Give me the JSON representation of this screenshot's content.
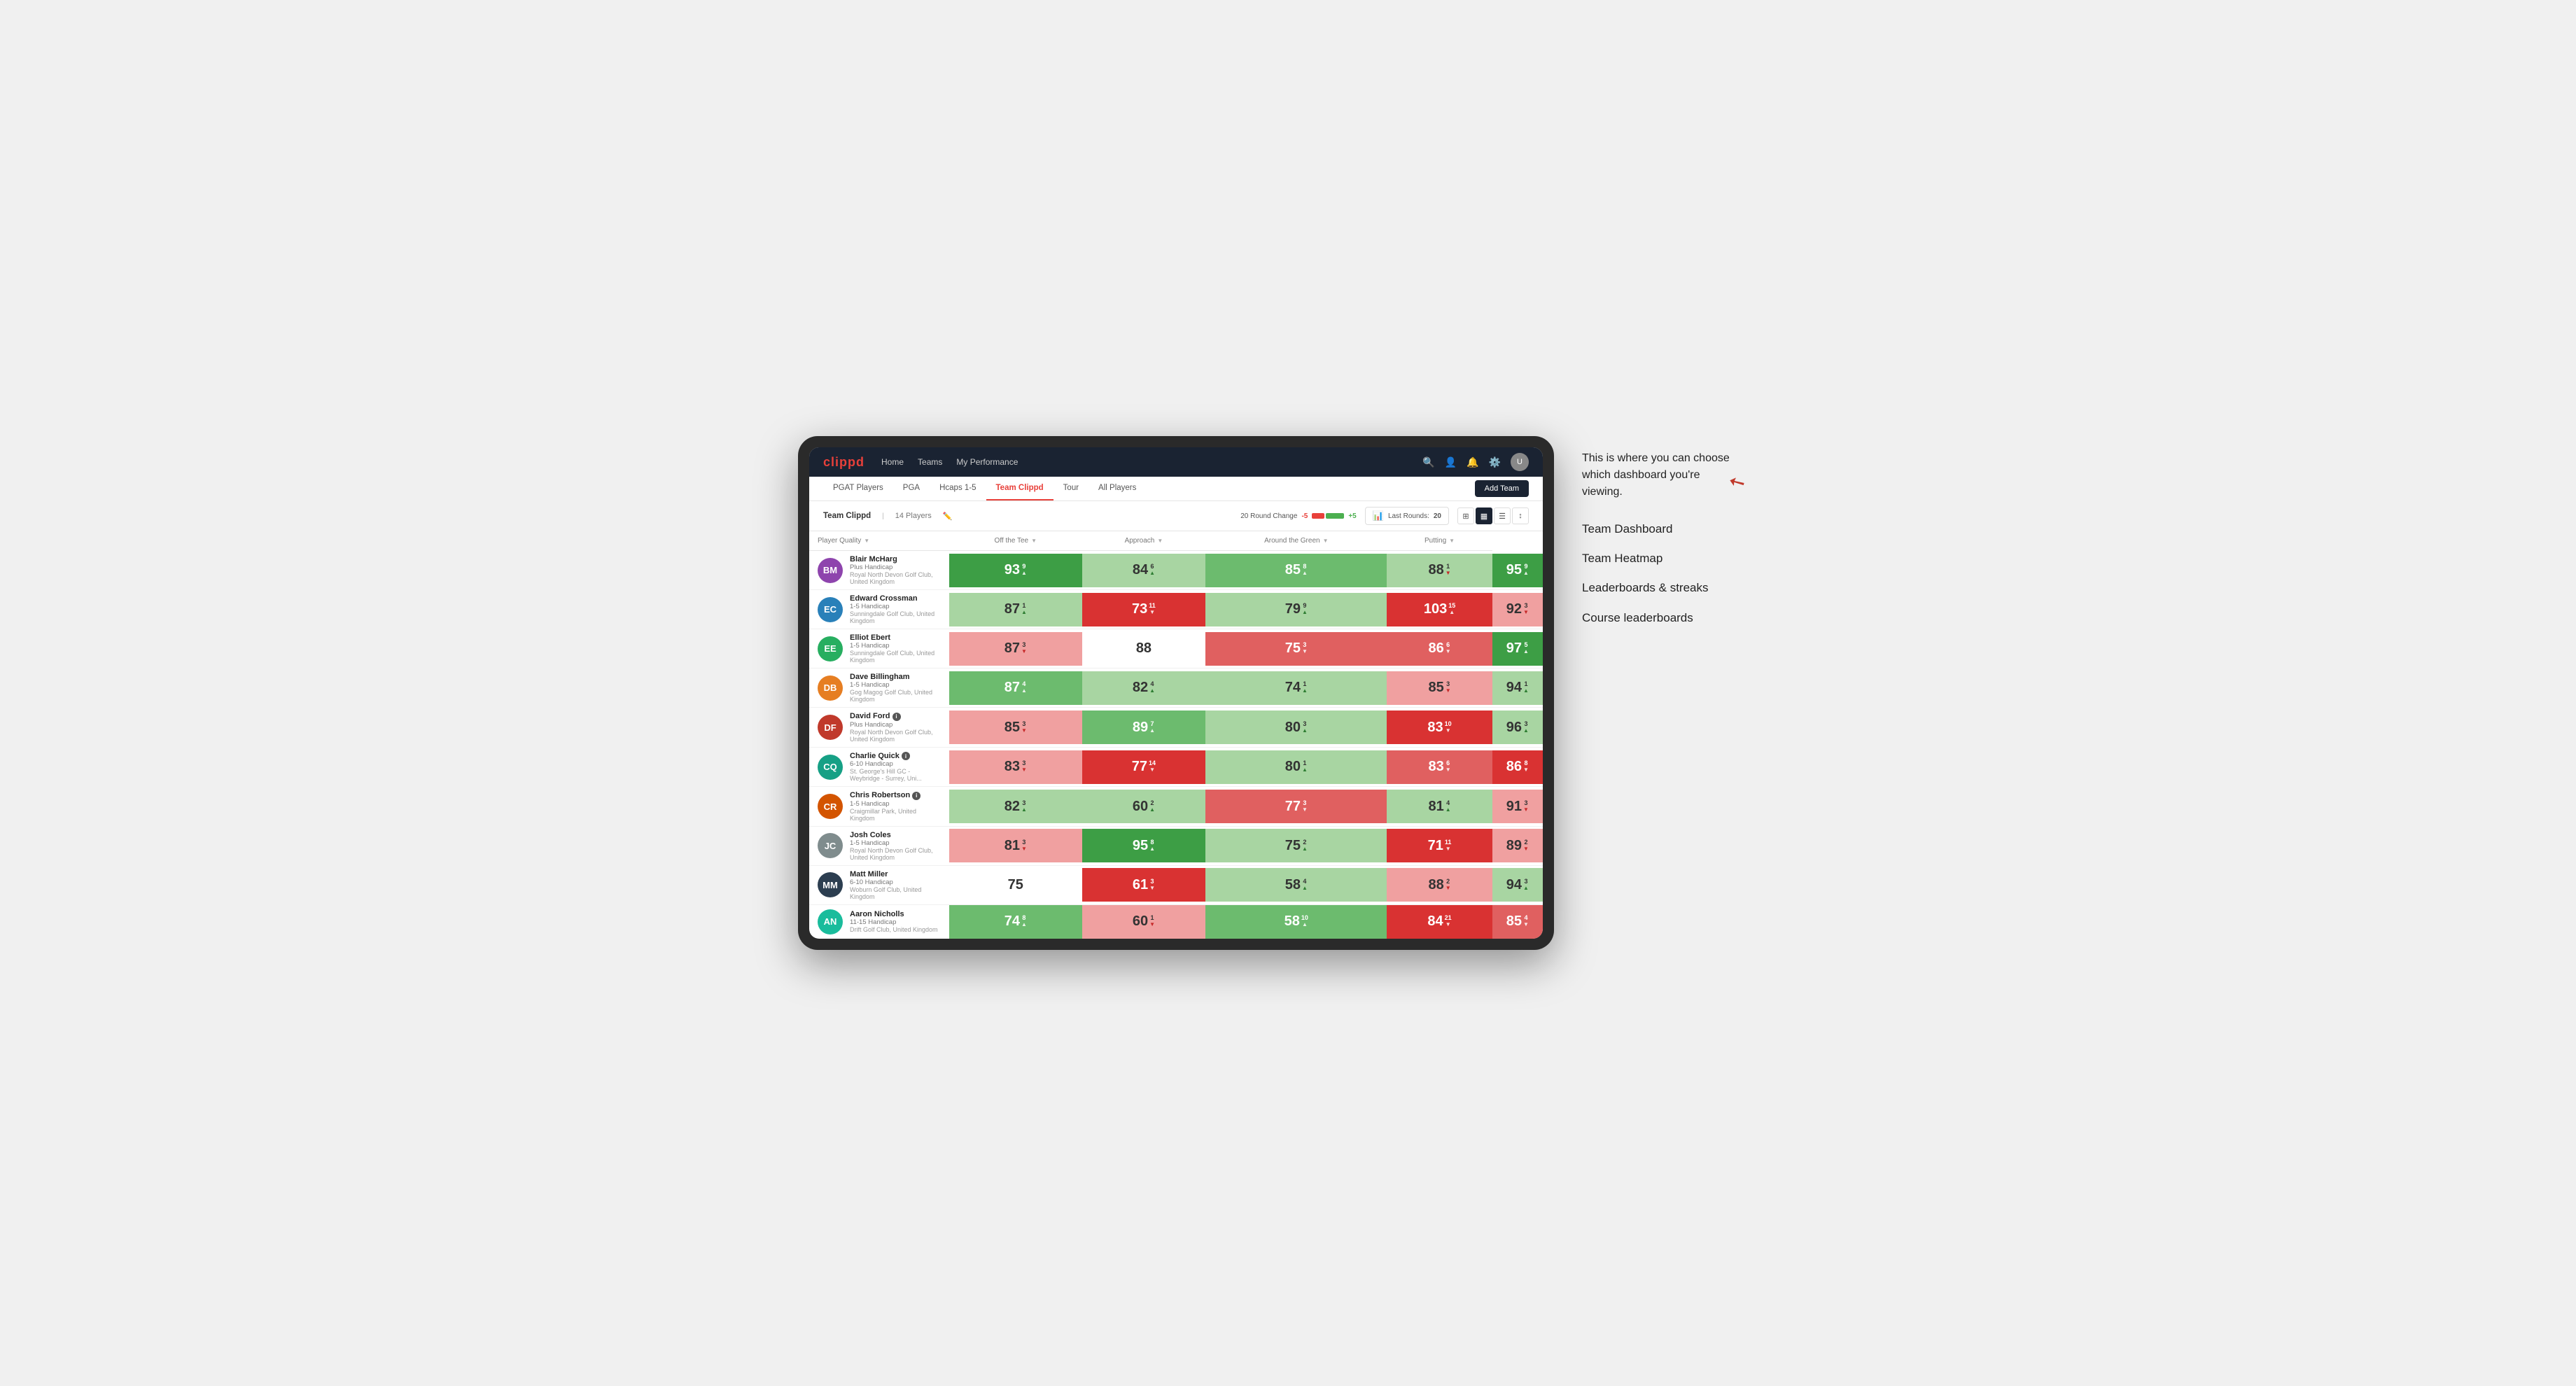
{
  "annotation": {
    "text": "This is where you can choose which dashboard you're viewing.",
    "items": [
      "Team Dashboard",
      "Team Heatmap",
      "Leaderboards & streaks",
      "Course leaderboards"
    ]
  },
  "nav": {
    "logo": "clippd",
    "links": [
      {
        "label": "Home",
        "active": false
      },
      {
        "label": "Teams",
        "active": false
      },
      {
        "label": "My Performance",
        "active": false
      }
    ],
    "icons": [
      "search",
      "user",
      "bell",
      "settings",
      "avatar"
    ]
  },
  "sub_nav": {
    "links": [
      {
        "label": "PGAT Players",
        "active": false
      },
      {
        "label": "PGA",
        "active": false
      },
      {
        "label": "Hcaps 1-5",
        "active": false
      },
      {
        "label": "Team Clippd",
        "active": true
      },
      {
        "label": "Tour",
        "active": false
      },
      {
        "label": "All Players",
        "active": false
      }
    ],
    "add_team_label": "Add Team"
  },
  "team_header": {
    "team_name": "Team Clippd",
    "player_count": "14 Players",
    "round_change_label": "20 Round Change",
    "change_minus": "-5",
    "change_plus": "+5",
    "last_rounds_label": "Last Rounds:",
    "last_rounds_value": "20"
  },
  "table": {
    "columns": [
      {
        "label": "Player Quality",
        "sort": true
      },
      {
        "label": "Off the Tee",
        "sort": true
      },
      {
        "label": "Approach",
        "sort": true
      },
      {
        "label": "Around the Green",
        "sort": true
      },
      {
        "label": "Putting",
        "sort": true
      }
    ],
    "players": [
      {
        "name": "Blair McHarg",
        "handicap": "Plus Handicap",
        "club": "Royal North Devon Golf Club, United Kingdom",
        "initials": "BM",
        "scores": [
          {
            "value": "93",
            "change": "9",
            "dir": "up",
            "color": "green-dark"
          },
          {
            "value": "84",
            "change": "6",
            "dir": "up",
            "color": "green-light"
          },
          {
            "value": "85",
            "change": "8",
            "dir": "up",
            "color": "green-mid"
          },
          {
            "value": "88",
            "change": "1",
            "dir": "down",
            "color": "green-light"
          },
          {
            "value": "95",
            "change": "9",
            "dir": "up",
            "color": "green-dark"
          }
        ]
      },
      {
        "name": "Edward Crossman",
        "handicap": "1-5 Handicap",
        "club": "Sunningdale Golf Club, United Kingdom",
        "initials": "EC",
        "scores": [
          {
            "value": "87",
            "change": "1",
            "dir": "up",
            "color": "green-light"
          },
          {
            "value": "73",
            "change": "11",
            "dir": "down",
            "color": "red-dark"
          },
          {
            "value": "79",
            "change": "9",
            "dir": "up",
            "color": "green-light"
          },
          {
            "value": "103",
            "change": "15",
            "dir": "up",
            "color": "red-dark"
          },
          {
            "value": "92",
            "change": "3",
            "dir": "down",
            "color": "red-light"
          }
        ]
      },
      {
        "name": "Elliot Ebert",
        "handicap": "1-5 Handicap",
        "club": "Sunningdale Golf Club, United Kingdom",
        "initials": "EE",
        "scores": [
          {
            "value": "87",
            "change": "3",
            "dir": "down",
            "color": "red-light"
          },
          {
            "value": "88",
            "change": "",
            "dir": "",
            "color": "white"
          },
          {
            "value": "75",
            "change": "3",
            "dir": "down",
            "color": "red-mid"
          },
          {
            "value": "86",
            "change": "6",
            "dir": "down",
            "color": "red-mid"
          },
          {
            "value": "97",
            "change": "5",
            "dir": "up",
            "color": "green-dark"
          }
        ]
      },
      {
        "name": "Dave Billingham",
        "handicap": "1-5 Handicap",
        "club": "Gog Magog Golf Club, United Kingdom",
        "initials": "DB",
        "scores": [
          {
            "value": "87",
            "change": "4",
            "dir": "up",
            "color": "green-mid"
          },
          {
            "value": "82",
            "change": "4",
            "dir": "up",
            "color": "green-light"
          },
          {
            "value": "74",
            "change": "1",
            "dir": "up",
            "color": "green-light"
          },
          {
            "value": "85",
            "change": "3",
            "dir": "down",
            "color": "red-light"
          },
          {
            "value": "94",
            "change": "1",
            "dir": "up",
            "color": "green-light"
          }
        ]
      },
      {
        "name": "David Ford",
        "handicap": "Plus Handicap",
        "club": "Royal North Devon Golf Club, United Kingdom",
        "initials": "DF",
        "has_info": true,
        "scores": [
          {
            "value": "85",
            "change": "3",
            "dir": "down",
            "color": "red-light"
          },
          {
            "value": "89",
            "change": "7",
            "dir": "up",
            "color": "green-mid"
          },
          {
            "value": "80",
            "change": "3",
            "dir": "up",
            "color": "green-light"
          },
          {
            "value": "83",
            "change": "10",
            "dir": "down",
            "color": "red-dark"
          },
          {
            "value": "96",
            "change": "3",
            "dir": "up",
            "color": "green-light"
          }
        ]
      },
      {
        "name": "Charlie Quick",
        "handicap": "6-10 Handicap",
        "club": "St. George's Hill GC - Weybridge - Surrey, Uni...",
        "initials": "CQ",
        "has_info": true,
        "scores": [
          {
            "value": "83",
            "change": "3",
            "dir": "down",
            "color": "red-light"
          },
          {
            "value": "77",
            "change": "14",
            "dir": "down",
            "color": "red-dark"
          },
          {
            "value": "80",
            "change": "1",
            "dir": "up",
            "color": "green-light"
          },
          {
            "value": "83",
            "change": "6",
            "dir": "down",
            "color": "red-mid"
          },
          {
            "value": "86",
            "change": "8",
            "dir": "down",
            "color": "red-dark"
          }
        ]
      },
      {
        "name": "Chris Robertson",
        "handicap": "1-5 Handicap",
        "club": "Craigmillar Park, United Kingdom",
        "initials": "CR",
        "has_info": true,
        "scores": [
          {
            "value": "82",
            "change": "3",
            "dir": "up",
            "color": "green-light"
          },
          {
            "value": "60",
            "change": "2",
            "dir": "up",
            "color": "green-light"
          },
          {
            "value": "77",
            "change": "3",
            "dir": "down",
            "color": "red-mid"
          },
          {
            "value": "81",
            "change": "4",
            "dir": "up",
            "color": "green-light"
          },
          {
            "value": "91",
            "change": "3",
            "dir": "down",
            "color": "red-light"
          }
        ]
      },
      {
        "name": "Josh Coles",
        "handicap": "1-5 Handicap",
        "club": "Royal North Devon Golf Club, United Kingdom",
        "initials": "JC",
        "scores": [
          {
            "value": "81",
            "change": "3",
            "dir": "down",
            "color": "red-light"
          },
          {
            "value": "95",
            "change": "8",
            "dir": "up",
            "color": "green-dark"
          },
          {
            "value": "75",
            "change": "2",
            "dir": "up",
            "color": "green-light"
          },
          {
            "value": "71",
            "change": "11",
            "dir": "down",
            "color": "red-dark"
          },
          {
            "value": "89",
            "change": "2",
            "dir": "down",
            "color": "red-light"
          }
        ]
      },
      {
        "name": "Matt Miller",
        "handicap": "6-10 Handicap",
        "club": "Woburn Golf Club, United Kingdom",
        "initials": "MM",
        "scores": [
          {
            "value": "75",
            "change": "",
            "dir": "",
            "color": "white"
          },
          {
            "value": "61",
            "change": "3",
            "dir": "down",
            "color": "red-dark"
          },
          {
            "value": "58",
            "change": "4",
            "dir": "up",
            "color": "green-light"
          },
          {
            "value": "88",
            "change": "2",
            "dir": "down",
            "color": "red-light"
          },
          {
            "value": "94",
            "change": "3",
            "dir": "up",
            "color": "green-light"
          }
        ]
      },
      {
        "name": "Aaron Nicholls",
        "handicap": "11-15 Handicap",
        "club": "Drift Golf Club, United Kingdom",
        "initials": "AN",
        "scores": [
          {
            "value": "74",
            "change": "8",
            "dir": "up",
            "color": "green-mid"
          },
          {
            "value": "60",
            "change": "1",
            "dir": "down",
            "color": "red-light"
          },
          {
            "value": "58",
            "change": "10",
            "dir": "up",
            "color": "green-mid"
          },
          {
            "value": "84",
            "change": "21",
            "dir": "down",
            "color": "red-dark"
          },
          {
            "value": "85",
            "change": "4",
            "dir": "down",
            "color": "red-mid"
          }
        ]
      }
    ]
  }
}
